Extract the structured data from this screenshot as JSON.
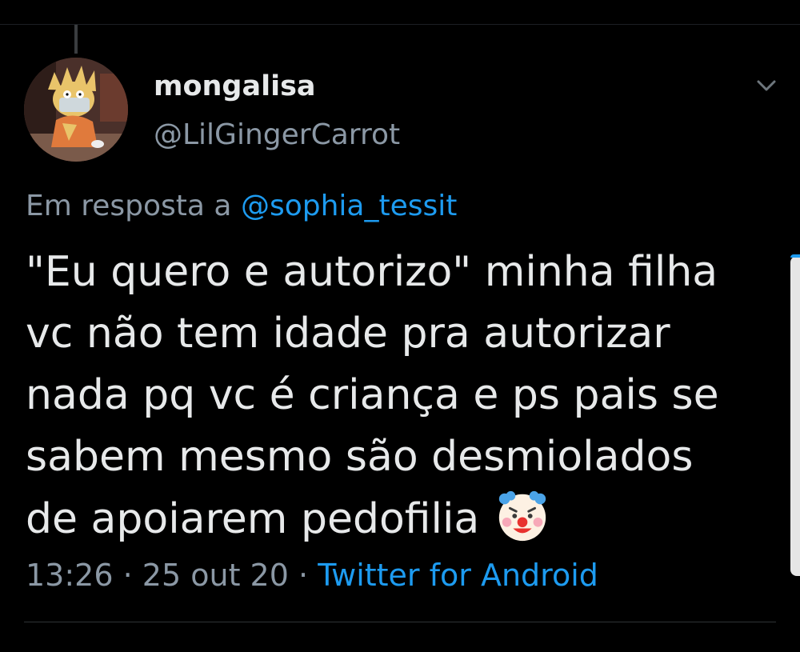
{
  "tweet": {
    "display_name": "mongalisa",
    "handle": "@LilGingerCarrot",
    "reply_prefix": "Em resposta a",
    "reply_to": "@sophia_tessit",
    "text_lines": [
      "\"Eu quero e autorizo\" minha filha",
      "vc não tem idade pra autorizar",
      "nada pq vc é criança e ps pais se",
      "sabem mesmo são desmiolados",
      "de apoiarem pedofilia"
    ],
    "emoji": "clown-face",
    "time": "13:26",
    "separator": "·",
    "date": "25 out 20",
    "source": "Twitter for Android"
  },
  "colors": {
    "background": "#000000",
    "text_primary": "#e7e9ea",
    "text_secondary": "#8b98a5",
    "link": "#1d9bf0",
    "divider": "#2f3336"
  },
  "icons": {
    "more": "chevron-down-icon",
    "avatar": "cartoon-avatar-image"
  }
}
